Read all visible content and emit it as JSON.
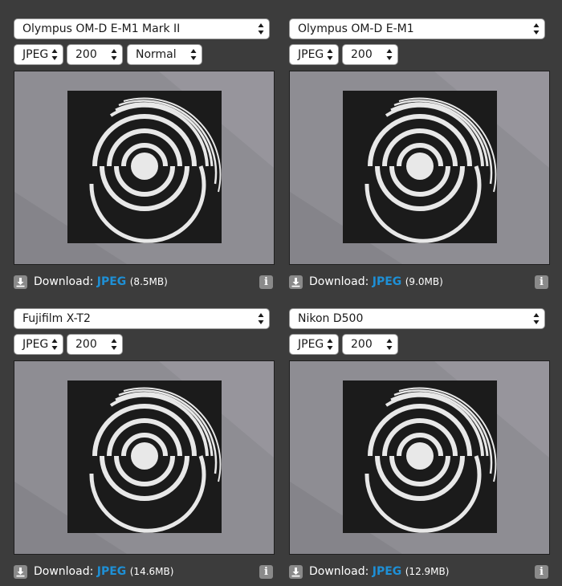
{
  "panels": [
    {
      "camera": "Olympus OM-D E-M1 Mark II",
      "format": "JPEG",
      "iso": "200",
      "mode": "Normal",
      "download_label": "Download:",
      "download_link": "JPEG",
      "download_size": "(8.5MB)"
    },
    {
      "camera": "Olympus OM-D E-M1",
      "format": "JPEG",
      "iso": "200",
      "download_label": "Download:",
      "download_link": "JPEG",
      "download_size": "(9.0MB)"
    },
    {
      "camera": "Fujifilm X-T2",
      "format": "JPEG",
      "iso": "200",
      "download_label": "Download:",
      "download_link": "JPEG",
      "download_size": "(14.6MB)"
    },
    {
      "camera": "Nikon D500",
      "format": "JPEG",
      "iso": "200",
      "download_label": "Download:",
      "download_link": "JPEG",
      "download_size": "(12.9MB)"
    }
  ],
  "info_glyph": "i",
  "colors": {
    "page_background": "#3c3c3c",
    "link": "#1e90d6",
    "icon_background": "#8a8a8a"
  }
}
